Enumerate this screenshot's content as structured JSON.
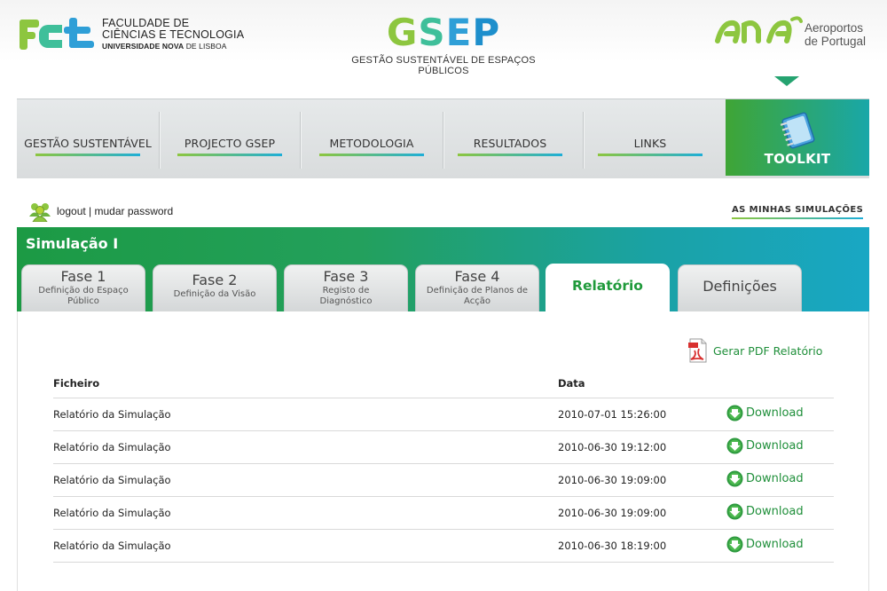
{
  "header": {
    "fct": {
      "logo_text": "FCt",
      "line1": "FACULDADE DE",
      "line2": "CIÊNCIAS E TECNOLOGIA",
      "line3_bold": "UNIVERSIDADE NOVA",
      "line3_rest": " DE LISBOA"
    },
    "gsep": {
      "title_g": "G",
      "title_s": "S",
      "title_e": "E",
      "title_p": "P",
      "subtitle": "GESTÃO SUSTENTÁVEL DE ESPAÇOS PÚBLICOS"
    },
    "ana": {
      "logo_text": "ANA",
      "line1": "Aeroportos",
      "line2": "de Portugal"
    }
  },
  "nav": {
    "items": [
      {
        "label": "GESTÃO SUSTENTÁVEL"
      },
      {
        "label": "PROJECTO GSEP"
      },
      {
        "label": "METODOLOGIA"
      },
      {
        "label": "RESULTADOS"
      },
      {
        "label": "LINKS"
      }
    ],
    "toolkit_label": "TOOLKIT"
  },
  "userbar": {
    "logout": "logout",
    "separator": " | ",
    "change_password": "mudar password",
    "my_simulations": "AS MINHAS SIMULAÇÕES"
  },
  "simulation": {
    "title": "Simulação I",
    "tabs": [
      {
        "title": "Fase 1",
        "subtitle": "Definição do Espaço Público"
      },
      {
        "title": "Fase 2",
        "subtitle": "Definição da Visão"
      },
      {
        "title": "Fase 3",
        "subtitle": "Registo de Diagnóstico"
      },
      {
        "title": "Fase 4",
        "subtitle": "Definição de Planos de Acção"
      },
      {
        "title": "Relatório",
        "subtitle": ""
      },
      {
        "title": "Definições",
        "subtitle": ""
      }
    ],
    "active_tab": "Relatório"
  },
  "report": {
    "generate_pdf": "Gerar PDF Relatório",
    "columns": {
      "file": "Ficheiro",
      "date": "Data"
    },
    "rows": [
      {
        "file": "Relatório da Simulação",
        "date": "2010-07-01 15:26:00",
        "action": "Download"
      },
      {
        "file": "Relatório da Simulação",
        "date": "2010-06-30 19:12:00",
        "action": "Download"
      },
      {
        "file": "Relatório da Simulação",
        "date": "2010-06-30 19:09:00",
        "action": "Download"
      },
      {
        "file": "Relatório da Simulação",
        "date": "2010-06-30 19:09:00",
        "action": "Download"
      },
      {
        "file": "Relatório da Simulação",
        "date": "2010-06-30 18:19:00",
        "action": "Download"
      }
    ]
  },
  "colors": {
    "green": "#1f9a3b",
    "lime": "#8dc63f",
    "cyan": "#1eaed7"
  },
  "icons": {
    "users": "users-icon",
    "toolkit": "notebook-icon",
    "pdf": "pdf-icon",
    "download": "download-arrow-icon"
  }
}
